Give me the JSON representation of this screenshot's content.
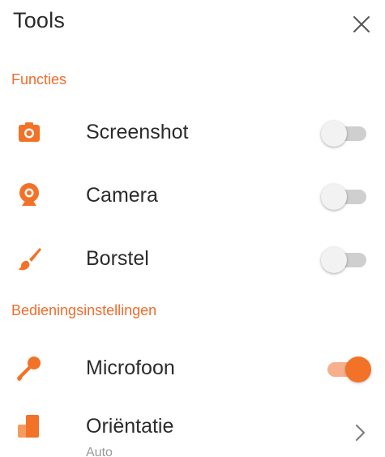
{
  "header": {
    "title": "Tools",
    "close_icon": "close-icon"
  },
  "sections": {
    "functions": {
      "label": "Functies",
      "items": [
        {
          "label": "Screenshot",
          "icon": "camera-icon",
          "enabled": false
        },
        {
          "label": "Camera",
          "icon": "webcam-icon",
          "enabled": false
        },
        {
          "label": "Borstel",
          "icon": "brush-icon",
          "enabled": false
        }
      ]
    },
    "controls": {
      "label": "Bedieningsinstellingen",
      "items": [
        {
          "label": "Microfoon",
          "icon": "microphone-icon",
          "enabled": true
        },
        {
          "label": "Oriëntatie",
          "value": "Auto",
          "icon": "orientation-icon",
          "control": "chevron-right-icon"
        }
      ]
    }
  },
  "colors": {
    "accent": "#f27227",
    "section_label": "#ef6c2c",
    "toggle_off_track": "#cfcfcf",
    "toggle_off_thumb": "#f2f2f2",
    "text": "#2b2b2b",
    "secondary_text": "#9a9a9a"
  }
}
